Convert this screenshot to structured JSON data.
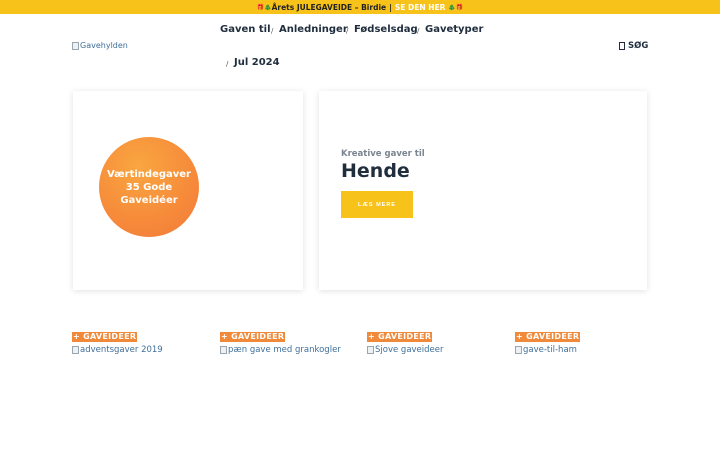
{
  "promo": {
    "emoji_left": "🎁🎄",
    "text": "Årets JULEGAVEIDE – Birdie",
    "separator": "|",
    "cta": "SE DEN HER",
    "emoji_right": "🎄🎁"
  },
  "logo": {
    "alt": "Gavehylden"
  },
  "nav": {
    "items": [
      {
        "label": "Gaven til"
      },
      {
        "label": "Anledninger"
      },
      {
        "label": "Fødselsdag"
      },
      {
        "label": "Gavetyper"
      },
      {
        "label": "Jul 2024"
      }
    ],
    "separator": "/"
  },
  "search": {
    "icon": "search-icon",
    "label": "SØG"
  },
  "featured_left": {
    "lines": [
      "Værtindegaver",
      "35 Gode",
      "Gaveidéer"
    ]
  },
  "featured_right": {
    "kicker": "Kreative gaver til",
    "title": "Hende",
    "button": "LÆS MERE"
  },
  "grid": [
    {
      "category": "+ GAVEIDEER",
      "image_alt": "adventsgaver 2019"
    },
    {
      "category": "+ GAVEIDEER",
      "image_alt": "pæn gave med grankogler"
    },
    {
      "category": "+ GAVEIDEER",
      "image_alt": "Sjove gaveideer"
    },
    {
      "category": "+ GAVEIDEER",
      "image_alt": "gave-til-ham"
    }
  ],
  "colors": {
    "promo_bg": "#f7c21a",
    "accent_orange": "#f08a3a",
    "button_yellow": "#f7c21a",
    "heading": "#1f2d3d"
  }
}
